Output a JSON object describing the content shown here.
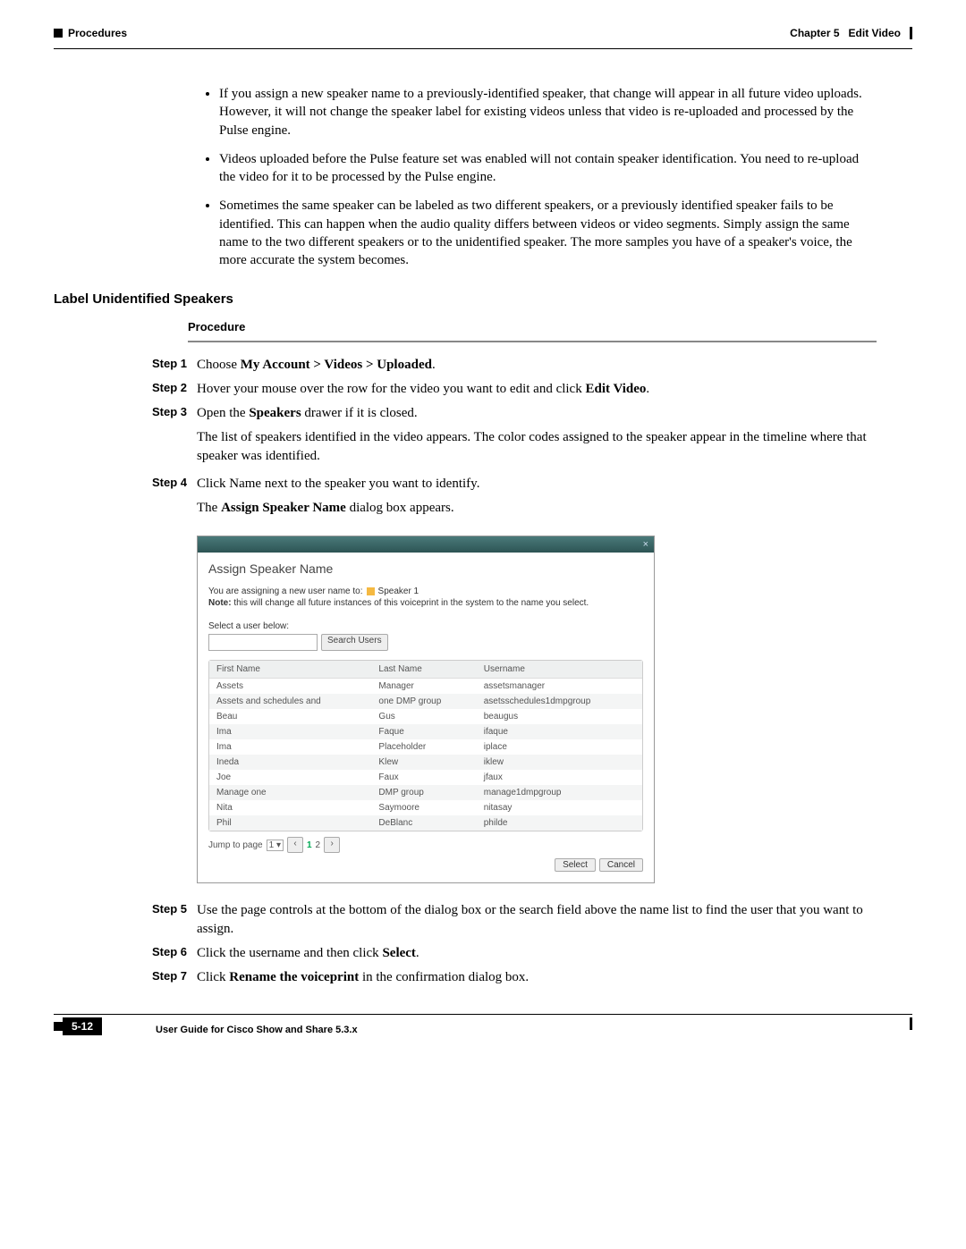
{
  "header": {
    "left": "Procedures",
    "chapter": "Chapter 5",
    "chapter_title": "Edit Video"
  },
  "bullets": [
    "If you assign a new speaker name to a previously-identified speaker, that change will appear in all future video uploads. However, it will not change the speaker label for existing videos unless that video is re-uploaded and processed by the Pulse engine.",
    "Videos uploaded before the Pulse feature set was enabled will not contain speaker identification. You need to re-upload the video for it to be processed by the Pulse engine.",
    "Sometimes the same speaker can be labeled as two different speakers, or a previously identified speaker fails to be identified. This can happen when the audio quality differs between videos or video segments. Simply assign the same name to the two different speakers or to the unidentified speaker. The more samples you have of a speaker's voice, the more accurate the system becomes."
  ],
  "section_heading": "Label Unidentified Speakers",
  "procedure_label": "Procedure",
  "steps": {
    "s1": {
      "label": "Step 1",
      "pre": "Choose ",
      "bold": "My Account > Videos > Uploaded",
      "post": "."
    },
    "s2": {
      "label": "Step 2",
      "pre": "Hover your mouse over the row for the video you want to edit and click ",
      "bold": "Edit Video",
      "post": "."
    },
    "s3": {
      "label": "Step 3",
      "pre": "Open the ",
      "bold": "Speakers",
      "post": " drawer if it is closed."
    },
    "s3_sub": "The list of speakers identified in the video appears. The color codes assigned to the speaker appear in the timeline where that speaker was identified.",
    "s4": {
      "label": "Step 4",
      "text": "Click Name next to the speaker you want to identify."
    },
    "s4_sub_pre": "The ",
    "s4_sub_bold": "Assign Speaker Name",
    "s4_sub_post": " dialog box appears.",
    "s5": {
      "label": "Step 5",
      "text": "Use the page controls at the bottom of the dialog box or the search field above the name list to find the user that you want to assign."
    },
    "s6": {
      "label": "Step 6",
      "pre": "Click the username and then click ",
      "bold": "Select",
      "post": "."
    },
    "s7": {
      "label": "Step 7",
      "pre": "Click ",
      "bold": "Rename the voiceprint",
      "post": " in the confirmation dialog box."
    }
  },
  "dialog": {
    "close": "×",
    "title": "Assign Speaker Name",
    "assign_prefix": "You are assigning a new user name to:",
    "speaker": "Speaker 1",
    "note_bold": "Note:",
    "note": " this will change all future instances of this voiceprint in the system to the name you select.",
    "select_label": "Select a user below:",
    "search_btn": "Search Users",
    "cols": {
      "c1": "First Name",
      "c2": "Last Name",
      "c3": "Username"
    },
    "rows": [
      {
        "fn": "Assets",
        "ln": "Manager",
        "un": "assetsmanager"
      },
      {
        "fn": "Assets and schedules and",
        "ln": "one DMP group",
        "un": "asetsschedules1dmpgroup"
      },
      {
        "fn": "Beau",
        "ln": "Gus",
        "un": "beaugus"
      },
      {
        "fn": "Ima",
        "ln": "Faque",
        "un": "ifaque"
      },
      {
        "fn": "Ima",
        "ln": "Placeholder",
        "un": "iplace"
      },
      {
        "fn": "Ineda",
        "ln": "Klew",
        "un": "iklew"
      },
      {
        "fn": "Joe",
        "ln": "Faux",
        "un": "jfaux"
      },
      {
        "fn": "Manage one",
        "ln": "DMP group",
        "un": "manage1dmpgroup"
      },
      {
        "fn": "Nita",
        "ln": "Saymoore",
        "un": "nitasay"
      },
      {
        "fn": "Phil",
        "ln": "DeBlanc",
        "un": "philde"
      }
    ],
    "jump": "Jump to page",
    "page_sel": "1",
    "p1": "1",
    "p2": "2",
    "select": "Select",
    "cancel": "Cancel"
  },
  "footer": {
    "title": "User Guide for Cisco Show and Share 5.3.x",
    "page": "5-12"
  }
}
